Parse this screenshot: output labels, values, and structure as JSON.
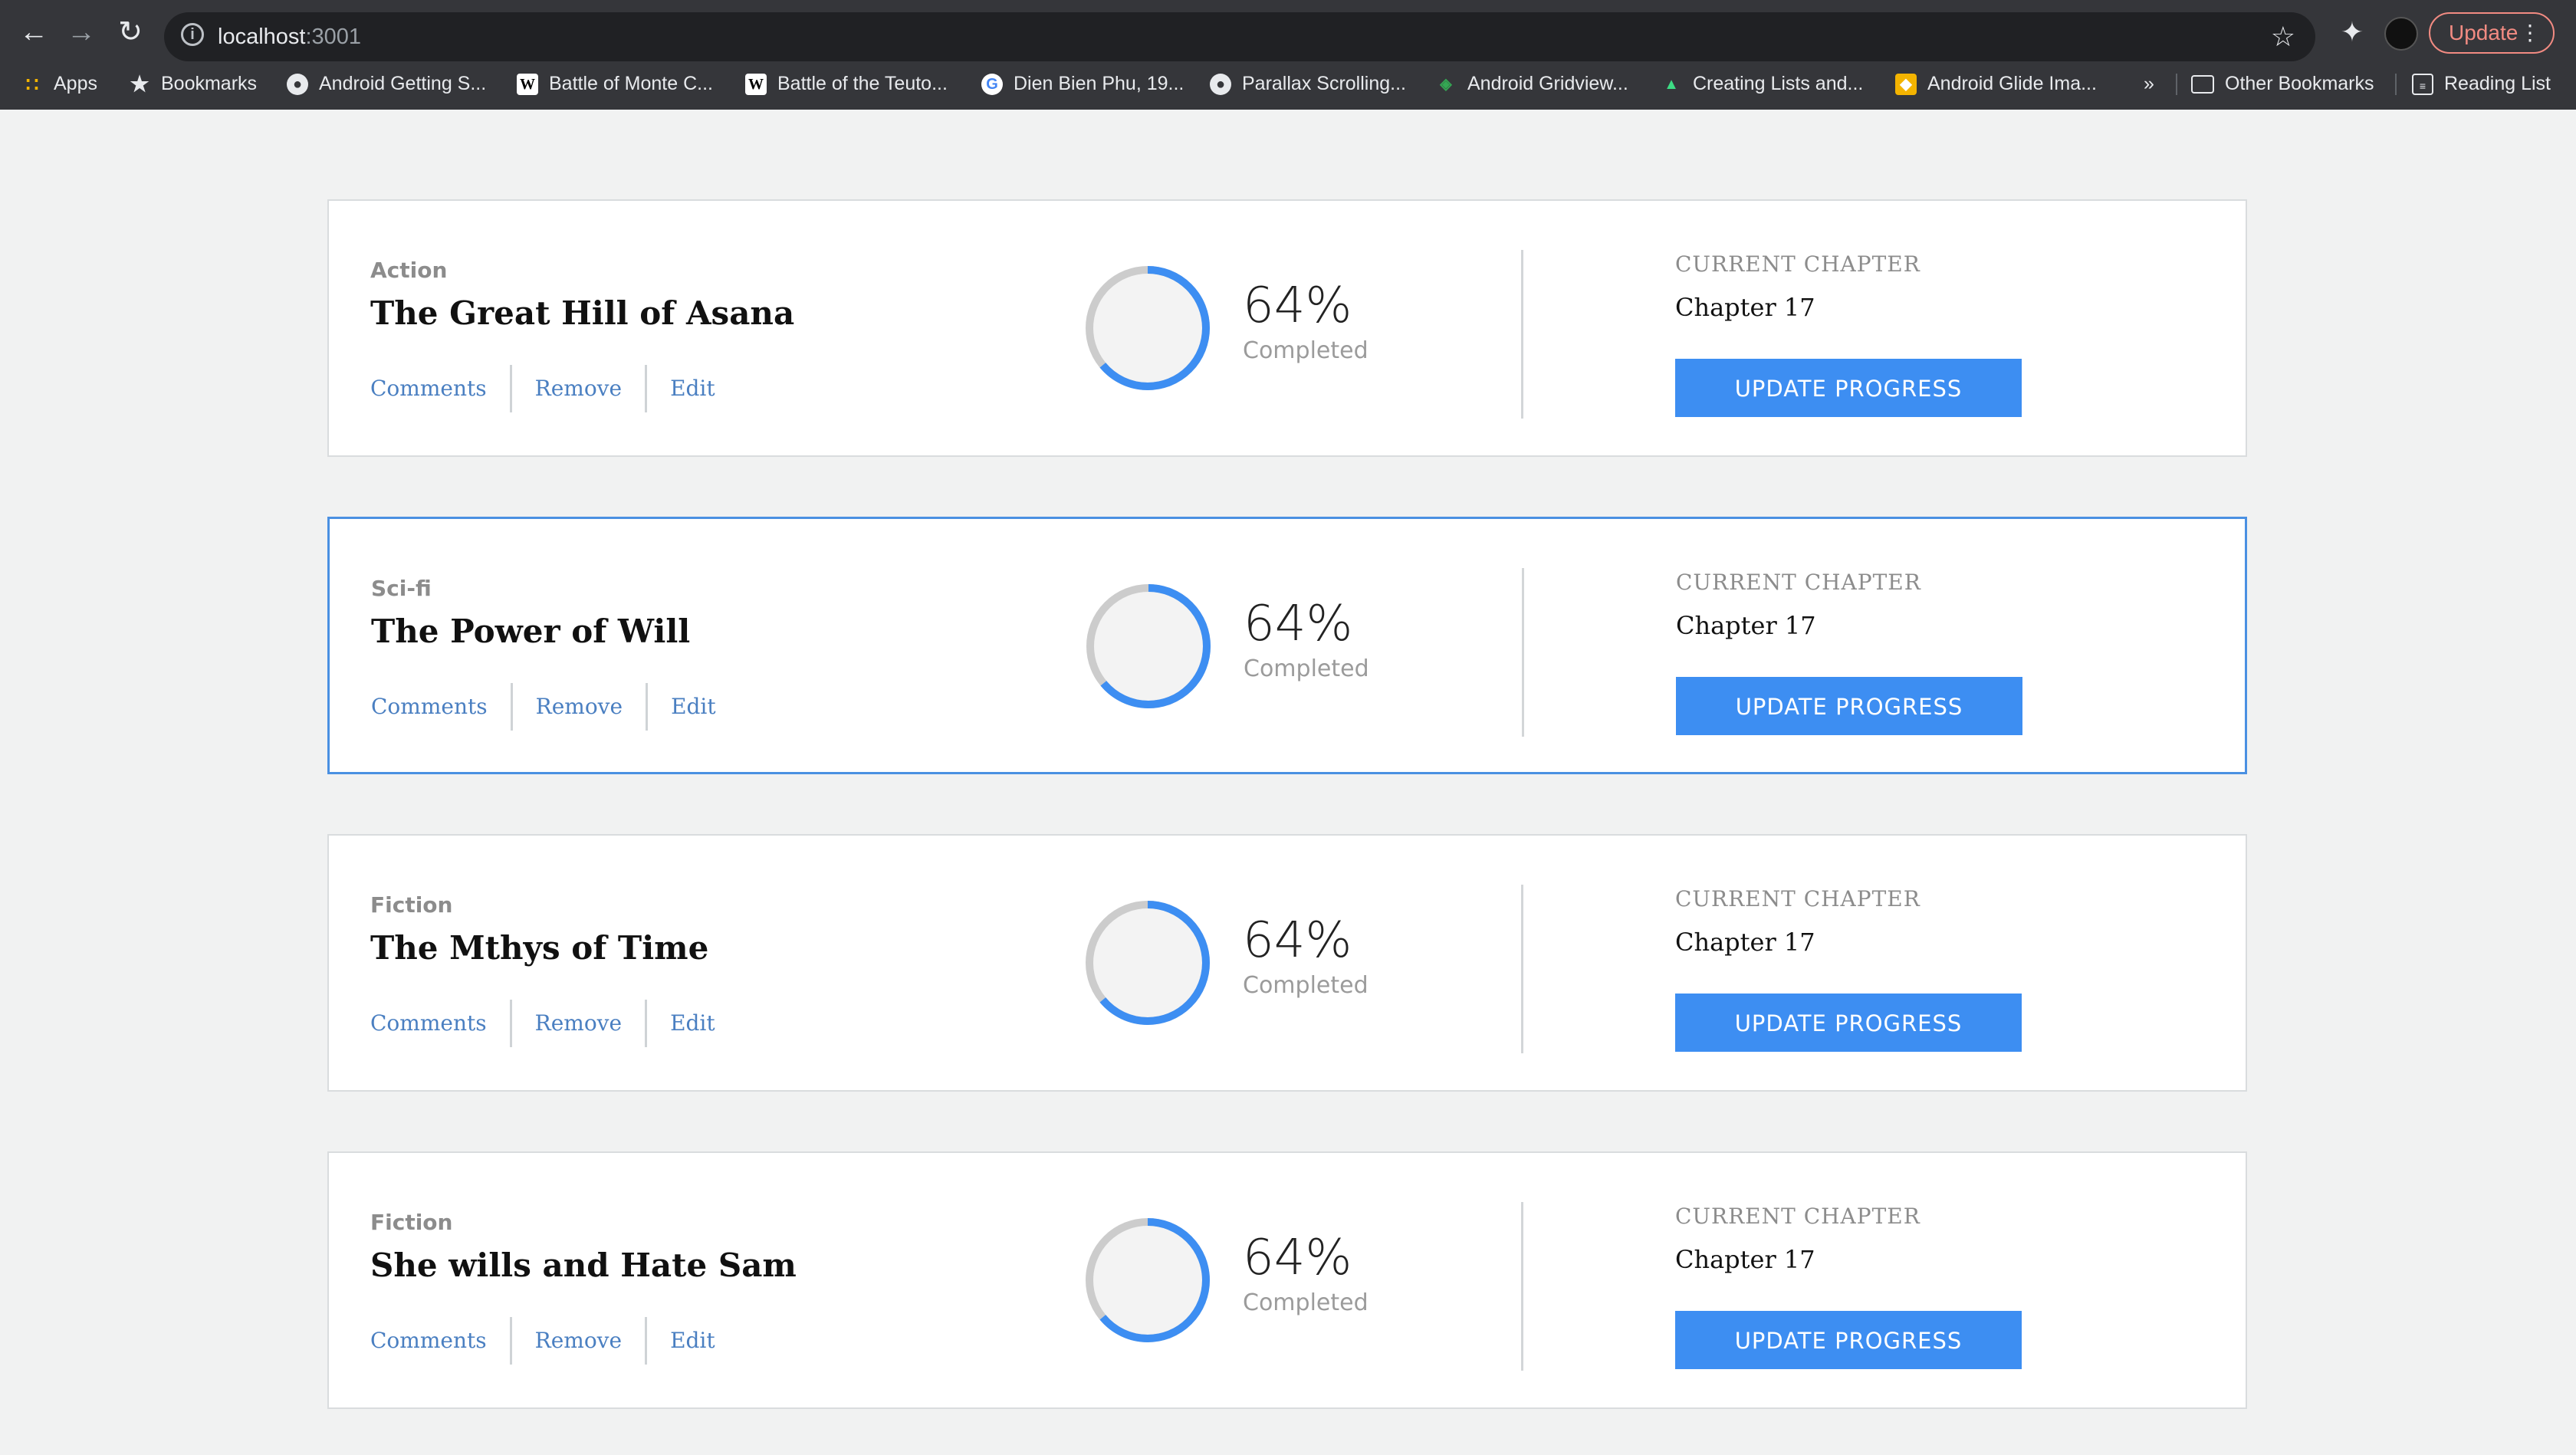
{
  "browser": {
    "url_host": "localhost",
    "url_port": ":3001",
    "update_label": "Update",
    "bookmarks": [
      {
        "label": "Apps",
        "icon": "apps-icon"
      },
      {
        "label": "Bookmarks",
        "icon": "star-icon"
      },
      {
        "label": "Android Getting S...",
        "icon": "globe-icon"
      },
      {
        "label": "Battle of Monte C...",
        "icon": "wikipedia-icon"
      },
      {
        "label": "Battle of the Teuto...",
        "icon": "wikipedia-icon"
      },
      {
        "label": "Dien Bien Phu, 19...",
        "icon": "google-icon"
      },
      {
        "label": "Parallax Scrolling...",
        "icon": "globe-icon"
      },
      {
        "label": "Android Gridview...",
        "icon": "layers-icon"
      },
      {
        "label": "Creating Lists and...",
        "icon": "android-icon"
      },
      {
        "label": "Android Glide Ima...",
        "icon": "glide-icon"
      }
    ],
    "overflow_label": "»",
    "other_bookmarks_label": "Other Bookmarks",
    "reading_list_label": "Reading List"
  },
  "books": [
    {
      "genre": "Action",
      "title": "The Great Hill of Asana",
      "percent_label": "64%",
      "percent": 64,
      "completed_label": "Completed",
      "chapter_label": "CURRENT CHAPTER",
      "chapter": "Chapter 17",
      "button_label": "UPDATE PROGRESS",
      "comments_label": "Comments",
      "remove_label": "Remove",
      "edit_label": "Edit"
    },
    {
      "genre": "Sci-fi",
      "title": "The Power of Will",
      "percent_label": "64%",
      "percent": 64,
      "completed_label": "Completed",
      "chapter_label": "CURRENT CHAPTER",
      "chapter": "Chapter 17",
      "button_label": "UPDATE PROGRESS",
      "comments_label": "Comments",
      "remove_label": "Remove",
      "edit_label": "Edit"
    },
    {
      "genre": "Fiction",
      "title": "The Mthys of Time",
      "percent_label": "64%",
      "percent": 64,
      "completed_label": "Completed",
      "chapter_label": "CURRENT CHAPTER",
      "chapter": "Chapter 17",
      "button_label": "UPDATE PROGRESS",
      "comments_label": "Comments",
      "remove_label": "Remove",
      "edit_label": "Edit"
    },
    {
      "genre": "Fiction",
      "title": "She wills and Hate Sam",
      "percent_label": "64%",
      "percent": 64,
      "completed_label": "Completed",
      "chapter_label": "CURRENT CHAPTER",
      "chapter": "Chapter 17",
      "button_label": "UPDATE PROGRESS",
      "comments_label": "Comments",
      "remove_label": "Remove",
      "edit_label": "Edit"
    }
  ],
  "colors": {
    "accent": "#3d8ef2",
    "ring_track": "#cccccc",
    "link": "#4a7fc1",
    "active_border": "#4a90e2"
  }
}
